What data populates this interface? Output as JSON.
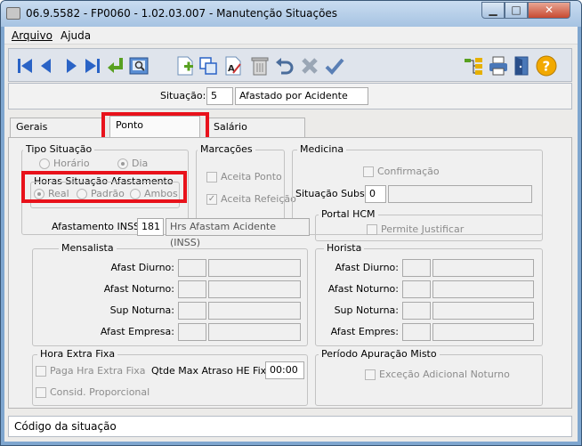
{
  "window": {
    "title": "06.9.5582 - FP0060 - 1.02.03.007 - Manutenção Situações",
    "min": "▁",
    "max": "□",
    "close": "✕"
  },
  "menu": {
    "items": [
      "Arquivo",
      "Ajuda"
    ]
  },
  "situacao": {
    "label": "Situação:",
    "code": "5",
    "description": "Afastado por Acidente"
  },
  "tabs": [
    "Gerais",
    "Ponto",
    "Salário"
  ],
  "tipo": {
    "title": "Tipo Situação",
    "options": [
      "Horário",
      "Dia"
    ],
    "selected": "Dia"
  },
  "horas": {
    "title": "Horas Situação Afastamento",
    "options": [
      "Real",
      "Padrão",
      "Ambos"
    ],
    "selected": "Real"
  },
  "marcacoes": {
    "title": "Marcações",
    "aceita_ponto": "Aceita Ponto",
    "aceita_refeicao": "Aceita Refeição",
    "aceita_ponto_checked": false,
    "aceita_refeicao_checked": true
  },
  "medicina": {
    "title": "Medicina",
    "confirmacao": "Confirmação",
    "subst_label": "Situação Subst:",
    "subst_value": "0"
  },
  "inss": {
    "label": "Afastamento INSS:",
    "code": "181",
    "description": "Hrs Afastam Acidente (INSS)"
  },
  "portal": {
    "title": "Portal HCM",
    "permite": "Permite Justificar"
  },
  "mensalista": {
    "title": "Mensalista",
    "rows": [
      "Afast Diurno:",
      "Afast Noturno:",
      "Sup Noturna:",
      "Afast Empresa:"
    ]
  },
  "horista": {
    "title": "Horista",
    "rows": [
      "Afast Diurno:",
      "Afast Noturno:",
      "Sup Noturna:",
      "Afast Empres:"
    ]
  },
  "hora_extra": {
    "title": "Hora Extra Fixa",
    "paga": "Paga Hra Extra Fixa",
    "consid": "Consid. Proporcional",
    "qtde_label": "Qtde Max Atraso HE Fixa:",
    "qtde_value": "00:00"
  },
  "periodo": {
    "title": "Período Apuração Misto",
    "excecao": "Exceção Adicional Noturno"
  },
  "status": {
    "text": "Código da situação"
  },
  "colors": {
    "accent": "#2a63c6",
    "highlight": "#e8121b"
  }
}
